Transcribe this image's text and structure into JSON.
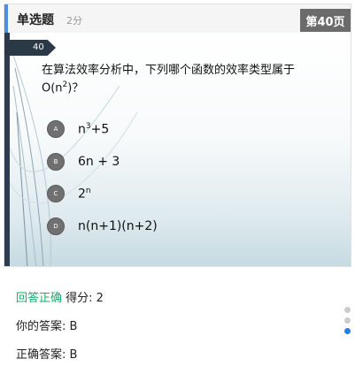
{
  "header": {
    "question_type": "单选题",
    "score_label": "2分",
    "page_label": "第40页"
  },
  "slide": {
    "question_number": "40",
    "question_text_prefix": "在算法效率分析中，下列哪个函数的效率类型属于O(n",
    "question_text_sup": "2",
    "question_text_suffix": ")？",
    "options": [
      {
        "letter": "A",
        "base": "n",
        "sup": "3",
        "rest": "+5"
      },
      {
        "letter": "B",
        "base": "6n + 3",
        "sup": "",
        "rest": ""
      },
      {
        "letter": "C",
        "base": "2",
        "sup": "n",
        "rest": ""
      },
      {
        "letter": "D",
        "base": "n(n+1)(n+2)",
        "sup": "",
        "rest": ""
      }
    ]
  },
  "result": {
    "status": "回答正确",
    "score_text": "得分: 2",
    "your_answer": "你的答案: B",
    "correct_answer": "正确答案: B"
  },
  "pagination": {
    "dot_count": 3,
    "active_index": 2
  },
  "colors": {
    "accent": "#4a8fe0",
    "correct": "#1aac6e",
    "badge_bg": "#6b6b6b",
    "dot_active": "#2a7de1"
  }
}
